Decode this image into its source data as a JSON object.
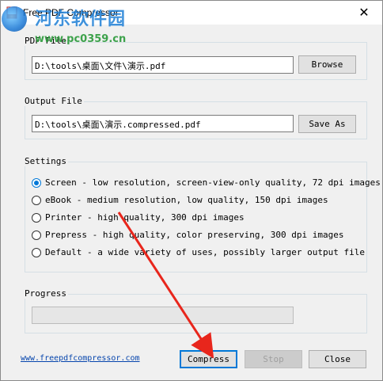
{
  "window": {
    "title": "Free PDF Compressor",
    "close_glyph": "✕"
  },
  "watermark": {
    "text": "河东软件园",
    "url": "www.pc0359.cn"
  },
  "pdf_file": {
    "label": "PDF File",
    "value": "D:\\tools\\桌面\\文件\\演示.pdf",
    "browse_label": "Browse"
  },
  "output_file": {
    "label": "Output File",
    "value": "D:\\tools\\桌面\\演示.compressed.pdf",
    "save_as_label": "Save As"
  },
  "settings": {
    "label": "Settings",
    "options": [
      {
        "label": "Screen - low resolution, screen-view-only quality, 72 dpi images",
        "checked": true
      },
      {
        "label": "eBook - medium resolution, low quality, 150 dpi images",
        "checked": false
      },
      {
        "label": "Printer - high quality, 300 dpi images",
        "checked": false
      },
      {
        "label": "Prepress - high quality, color preserving, 300 dpi images",
        "checked": false
      },
      {
        "label": "Default - a wide variety of uses, possibly larger output file",
        "checked": false
      }
    ]
  },
  "progress": {
    "label": "Progress",
    "value": 0
  },
  "footer": {
    "link": "www.freepdfcompressor.com",
    "compress_label": "Compress",
    "stop_label": "Stop",
    "close_label": "Close"
  },
  "colors": {
    "accent": "#0078d7",
    "annotation_arrow": "#e8261c",
    "link": "#0645ad"
  }
}
